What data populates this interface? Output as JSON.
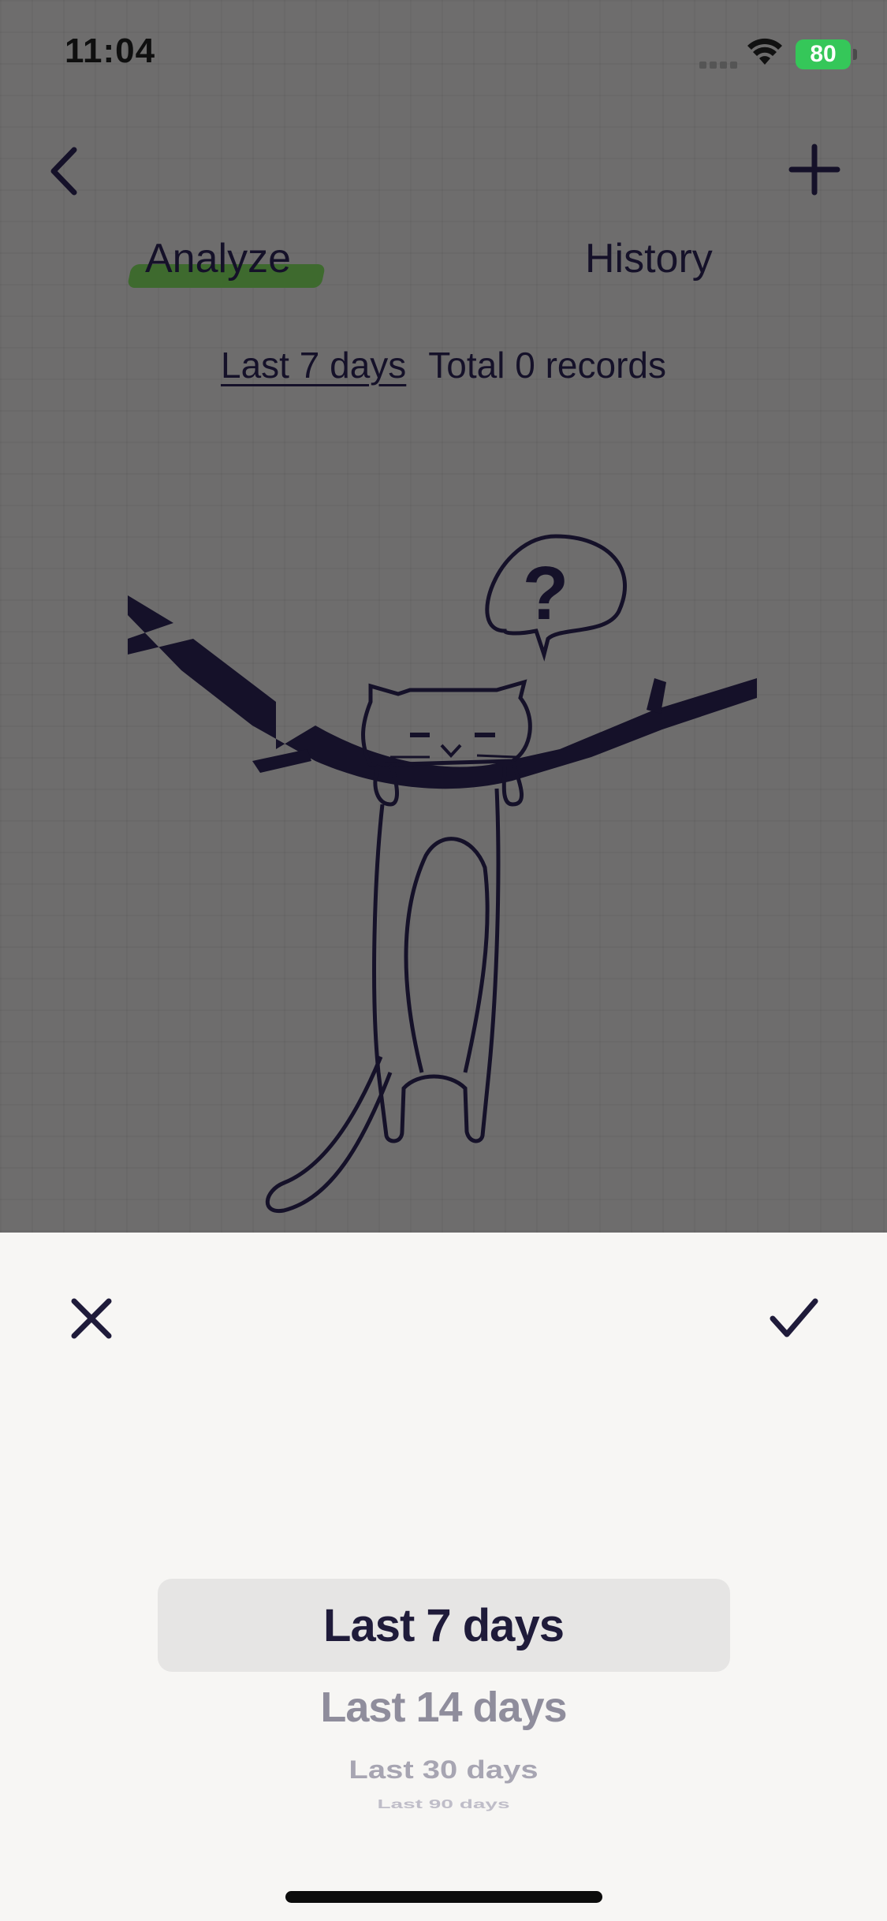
{
  "status_bar": {
    "time": "11:04",
    "battery": "80"
  },
  "nav": {
    "back_icon": "chevron-left-icon",
    "add_icon": "plus-icon"
  },
  "tabs": [
    {
      "label": "Analyze",
      "active": true
    },
    {
      "label": "History",
      "active": false
    }
  ],
  "range": {
    "selected_label": "Last 7 days",
    "total_text": "Total 0 records"
  },
  "illustration": {
    "description_icon": "cat-hanging-on-branch-illustration"
  },
  "sheet": {
    "close_icon": "close-icon",
    "confirm_icon": "checkmark-icon",
    "options": [
      "Last 7 days",
      "Last 14 days",
      "Last 30 days",
      "Last 90 days"
    ],
    "selected_index": 0
  },
  "colors": {
    "accent": "#151129",
    "highlight": "#3e6a2e",
    "overlay": "#6e6d6d",
    "sheet": "#f7f6f4"
  }
}
